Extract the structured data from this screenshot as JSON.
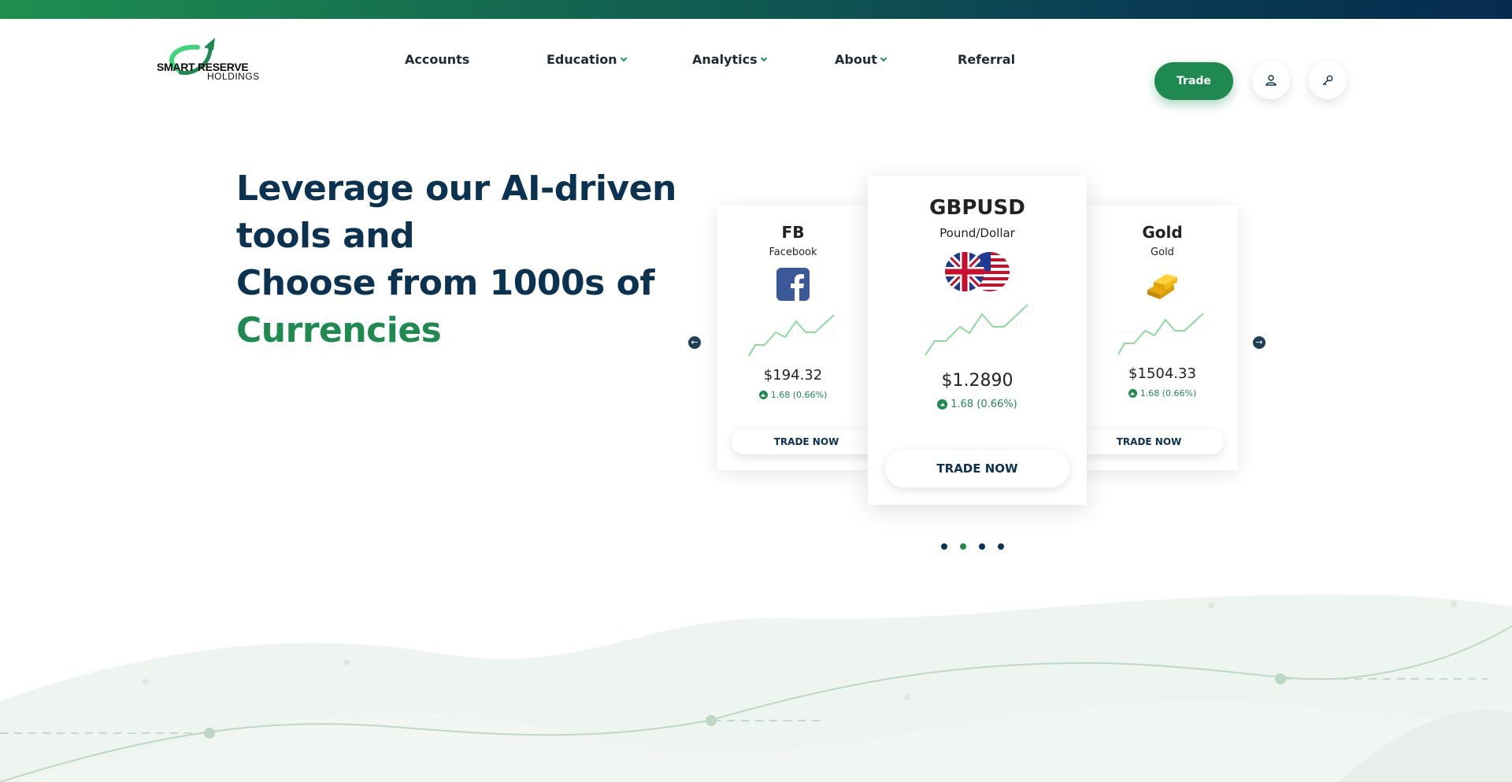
{
  "brand": {
    "name_line1": "SMART RESERVE",
    "name_line2": "HOLDINGS",
    "primary_color": "#1e8a4f",
    "navy_color": "#0b3250"
  },
  "nav": {
    "items": [
      {
        "label": "Accounts",
        "has_dropdown": false
      },
      {
        "label": "Education",
        "has_dropdown": true
      },
      {
        "label": "Analytics",
        "has_dropdown": true
      },
      {
        "label": "About",
        "has_dropdown": true
      },
      {
        "label": "Referral",
        "has_dropdown": false
      }
    ],
    "trade_label": "Trade",
    "user_icon": "user-icon",
    "key_icon": "key-icon"
  },
  "hero": {
    "line1": "Leverage our AI-driven",
    "line2": "tools and",
    "line3": "Choose from 1000s of",
    "accent": "Currencies"
  },
  "carousel": {
    "cards": [
      {
        "symbol": "FB",
        "name": "Facebook",
        "icon": "facebook-icon",
        "price": "$194.32",
        "change": "1.68 (0.66%)",
        "button": "TRADE NOW"
      },
      {
        "symbol": "GBPUSD",
        "name": "Pound/Dollar",
        "icon": "uk-us-flags-icon",
        "price": "$1.2890",
        "change": "1.68 (0.66%)",
        "button": "TRADE NOW"
      },
      {
        "symbol": "Gold",
        "name": "Gold",
        "icon": "gold-bars-icon",
        "price": "$1504.33",
        "change": "1.68 (0.66%)",
        "button": "TRADE NOW"
      }
    ],
    "active_index": 1,
    "page_count": 4,
    "active_page": 1,
    "prev_icon": "arrow-left-icon",
    "next_icon": "arrow-right-icon"
  }
}
